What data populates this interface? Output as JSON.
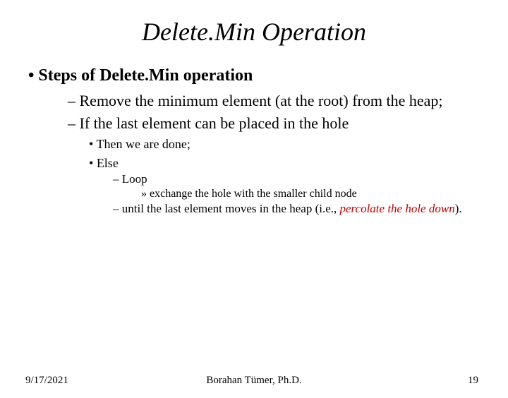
{
  "title": "Delete.Min Operation",
  "bullet1": "Steps of Delete.Min operation",
  "sub1": "Remove the minimum element (at the root) from the heap;",
  "sub2": "If the last element can be placed in the hole",
  "sub2a": "Then we are done;",
  "sub2b": "Else",
  "loop": "Loop",
  "exchange": "exchange the hole with the smaller child node",
  "until_pre": "until the last element moves in the heap (i.e., ",
  "percolate": "percolate the hole down",
  "until_post": ").",
  "footer": {
    "date": "9/17/2021",
    "author": "Borahan Tümer, Ph.D.",
    "page": "19"
  }
}
